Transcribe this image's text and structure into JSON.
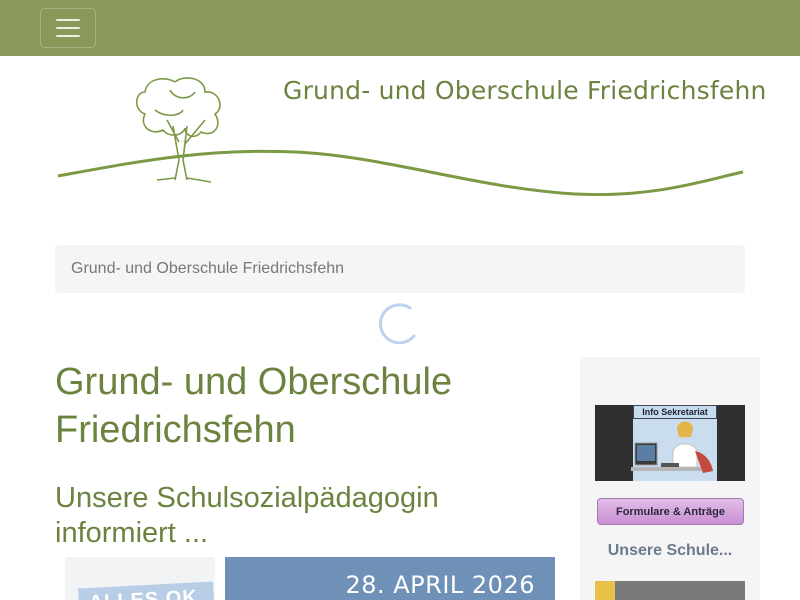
{
  "nav": {
    "menu_toggle_icon": "hamburger-menu-icon"
  },
  "header": {
    "school_name": "Grund- und Oberschule Friedrichsfehn",
    "logo_icon": "tree-icon"
  },
  "breadcrumb": {
    "current": "Grund- und Oberschule Friedrichsfehn"
  },
  "main": {
    "page_title": "Grund- und Oberschule Friedrichsfehn",
    "article_title": "Unsere Schulsozialpädagogin informiert ...",
    "image_badge": "ALLES OK",
    "image_date": "28. APRIL 2026"
  },
  "sidebar": {
    "info_label": "Info Sekretariat",
    "forms_button": "Formulare & Anträge",
    "heading": "Unsere Schule..."
  },
  "colors": {
    "topbar": "#88995a",
    "accent_green": "#6c8340"
  }
}
